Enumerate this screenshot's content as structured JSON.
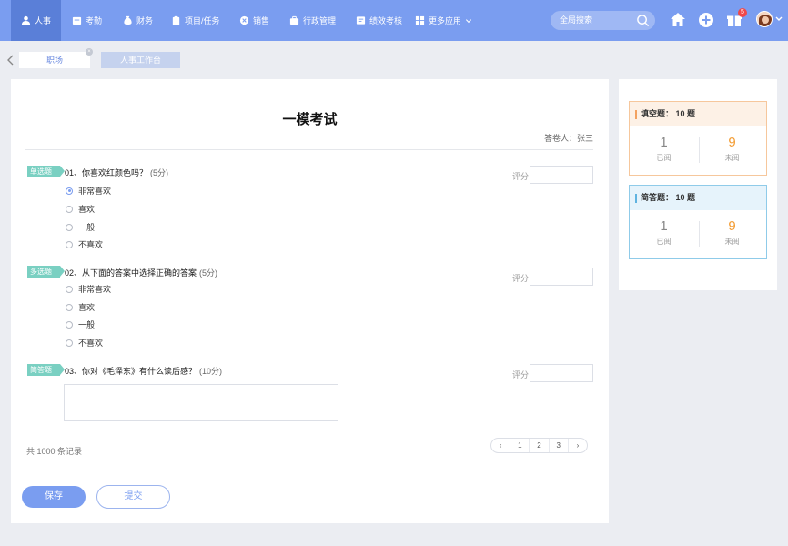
{
  "nav": {
    "items": [
      {
        "label": "人事",
        "icon": "user-icon",
        "active": true
      },
      {
        "label": "考勤",
        "icon": "attendance-icon"
      },
      {
        "label": "财务",
        "icon": "money-bag-icon"
      },
      {
        "label": "项目/任务",
        "icon": "clipboard-icon"
      },
      {
        "label": "销售",
        "icon": "sales-icon"
      },
      {
        "label": "行政管理",
        "icon": "briefcase-icon"
      },
      {
        "label": "绩效考核",
        "icon": "performance-icon"
      },
      {
        "label": "更多应用",
        "icon": "grid-icon"
      }
    ],
    "search_placeholder": "全局搜索",
    "notification_count": "5"
  },
  "tabs": {
    "items": [
      "职场",
      "人事工作台"
    ]
  },
  "exam": {
    "title": "一模考试",
    "answerer": "答卷人：张三",
    "score_label": "评分",
    "questions": [
      {
        "tag": "单选题",
        "text": "01、你喜欢红颜色吗？",
        "points": "(5分)",
        "options": [
          "非常喜欢",
          "喜欢",
          "一般",
          "不喜欢"
        ],
        "selected": 0
      },
      {
        "tag": "多选题",
        "text": "02、从下面的答案中选择正确的答案",
        "points": "(5分)",
        "options": [
          "非常喜欢",
          "喜欢",
          "一般",
          "不喜欢"
        ]
      },
      {
        "tag": "简答题",
        "text": "03、你对《毛泽东》有什么读后感？",
        "points": "(10分)"
      }
    ],
    "records": "共 1000 条记录",
    "pager": [
      "‹",
      "1",
      "2",
      "3",
      "›"
    ],
    "save_label": "保存",
    "submit_label": "提交"
  },
  "summary": {
    "fill": {
      "title": "填空题： 10 题",
      "read": "1",
      "read_label": "已阅",
      "unread": "9",
      "unread_label": "未阅",
      "color": "#f39c33"
    },
    "short": {
      "title": "简答题： 10 题",
      "read": "1",
      "read_label": "已阅",
      "unread": "9",
      "unread_label": "未阅",
      "color": "#5fb3e0"
    }
  }
}
